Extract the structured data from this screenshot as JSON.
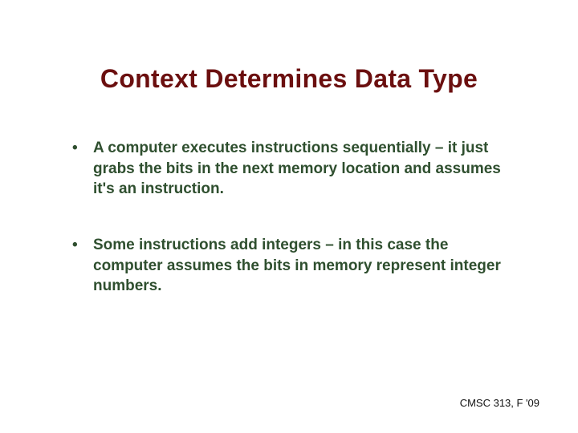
{
  "title": "Context Determines Data Type",
  "bullets": [
    "A computer executes instructions sequentially – it just grabs the bits in the next memory location and assumes it's an instruction.",
    "Some instructions add integers – in this case the computer assumes the bits in memory represent integer numbers."
  ],
  "footer": "CMSC 313, F '09"
}
